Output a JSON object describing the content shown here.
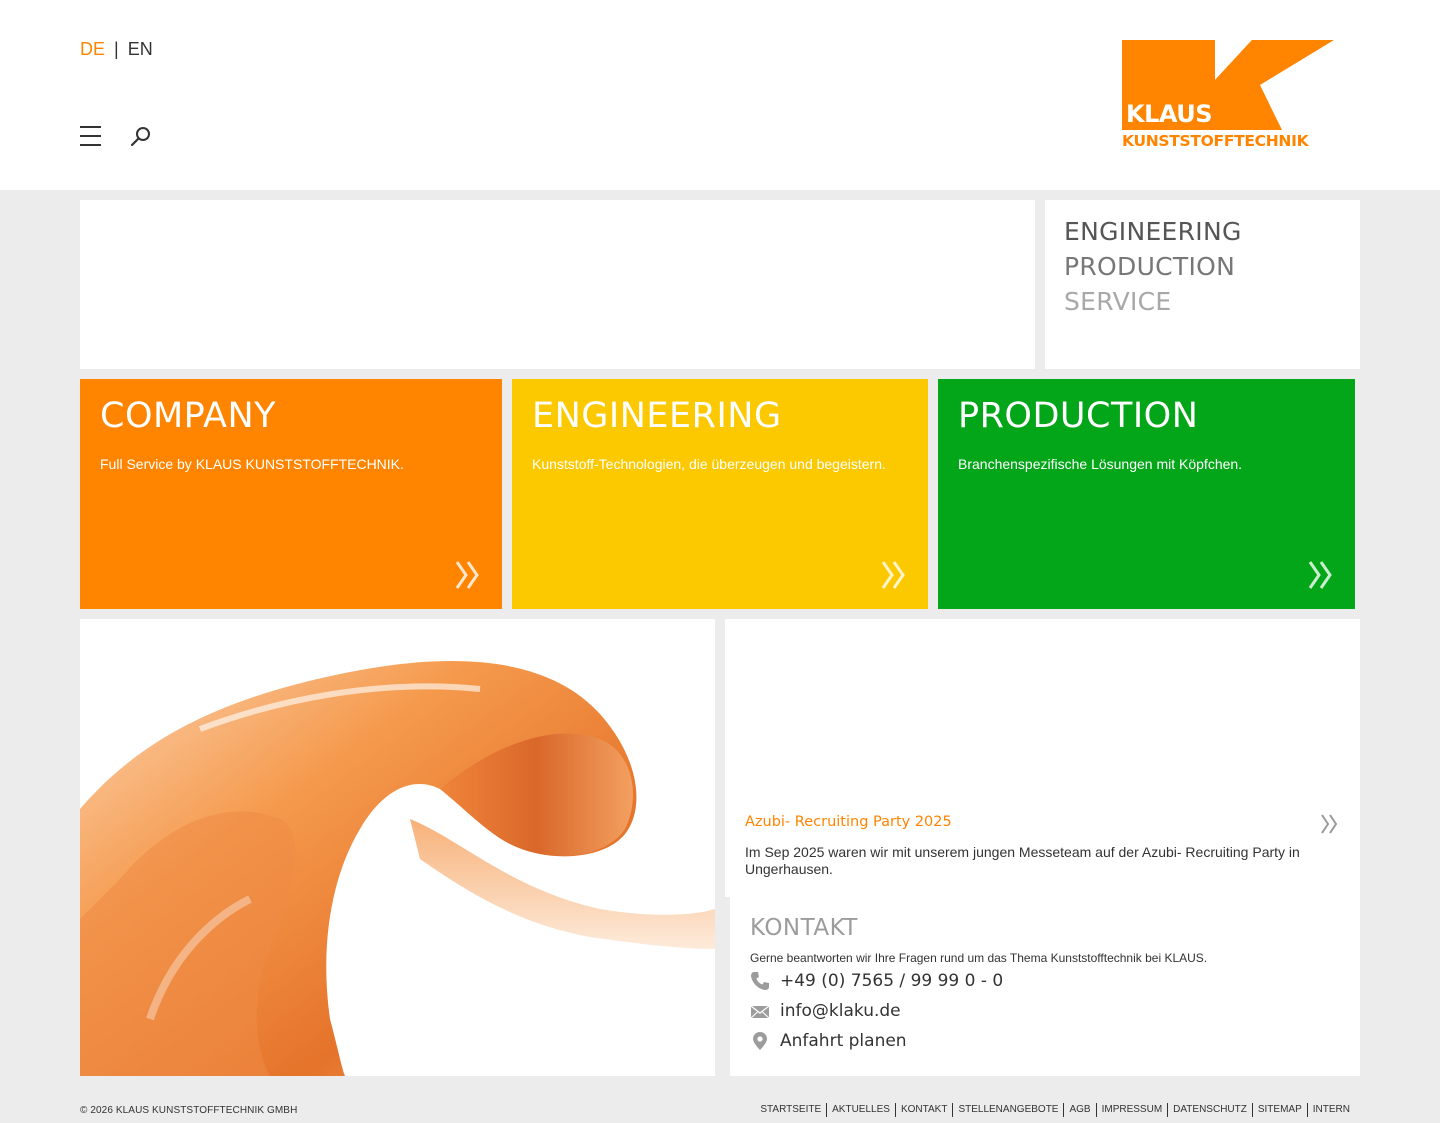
{
  "header": {
    "lang_de": "DE",
    "lang_sep": "|",
    "lang_en": "EN",
    "logo_line1": "KLAUS",
    "logo_line2": "KUNSTSTOFFTECHNIK"
  },
  "colors": {
    "orange": "#ff8400",
    "yellow": "#fcc900",
    "green": "#03a618",
    "dark": "#333333"
  },
  "claim": [
    {
      "label": "ENGINEERING",
      "color": "#555555"
    },
    {
      "label": "PRODUCTION",
      "color": "#777777"
    },
    {
      "label": "SERVICE",
      "color": "#a8a8a8"
    }
  ],
  "tiles": [
    {
      "title": "COMPANY",
      "text": "Full Service by KLAUS KUNSTSTOFFTECHNIK."
    },
    {
      "title": "ENGINEERING",
      "text": "Kunststoff-Technologien, die überzeugen und begeistern."
    },
    {
      "title": "PRODUCTION",
      "text": "Branchenspezifische Lösungen mit Köpfchen."
    }
  ],
  "news": {
    "title": "Azubi- Recruiting Party 2025",
    "text": "Im Sep 2025 waren wir mit unserem jungen Messeteam auf der Azubi- Recruiting Party in Ungerhausen."
  },
  "contact": {
    "heading": "KONTAKT",
    "intro": "Gerne beantworten wir Ihre Fragen rund um das Thema Kunststofftechnik bei KLAUS.",
    "phone": "+49 (0) 7565 / 99 99 0 - 0",
    "email": "info@klaku.de",
    "directions": "Anfahrt planen"
  },
  "footer": {
    "copyright": "© 2026 KLAUS KUNSTSTOFFTECHNIK GMBH",
    "links": [
      "STARTSEITE",
      "AKTUELLES",
      "KONTAKT",
      "STELLENANGEBOTE",
      "AGB",
      "IMPRESSUM",
      "DATENSCHUTZ",
      "SITEMAP",
      "INTERN"
    ]
  }
}
